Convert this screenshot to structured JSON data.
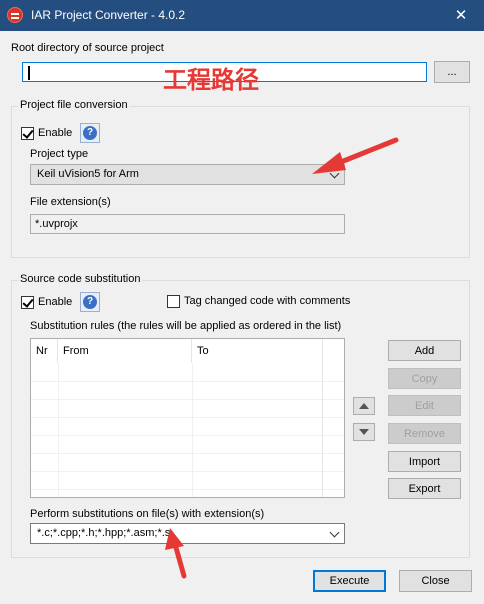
{
  "window": {
    "title": "IAR Project Converter - 4.0.2",
    "close_glyph": "✕",
    "icon": "iar-app-icon"
  },
  "root": {
    "label": "Root directory of source project",
    "path_value": "",
    "browse_label": "..."
  },
  "project_conversion": {
    "group_title": "Project file conversion",
    "enable_label": "Enable",
    "enable_checked": true,
    "help_glyph": "?",
    "project_type_label": "Project type",
    "project_type_value": "Keil uVision5 for Arm",
    "file_ext_label": "File extension(s)",
    "file_ext_value": "*.uvprojx"
  },
  "substitution": {
    "group_title": "Source code substitution",
    "enable_label": "Enable",
    "enable_checked": true,
    "help_glyph": "?",
    "tag_label": "Tag changed code with comments",
    "tag_checked": false,
    "rules_label": "Substitution rules (the rules will be applied as ordered in the list)",
    "columns": [
      "Nr",
      "From",
      "To"
    ],
    "rows": [],
    "buttons": {
      "add": "Add",
      "copy": "Copy",
      "edit": "Edit",
      "remove": "Remove",
      "import": "Import",
      "export": "Export"
    },
    "ext_label": "Perform substitutions on file(s) with extension(s)",
    "ext_value": "*.c;*.cpp;*.h;*.hpp;*.asm;*.s"
  },
  "footer": {
    "execute": "Execute",
    "close": "Close"
  },
  "annotation": {
    "text": "工程路径",
    "color": "#e53935"
  },
  "colors": {
    "titlebar": "#244d80",
    "focus_border": "#0078d7",
    "annotation_red": "#e53935"
  }
}
